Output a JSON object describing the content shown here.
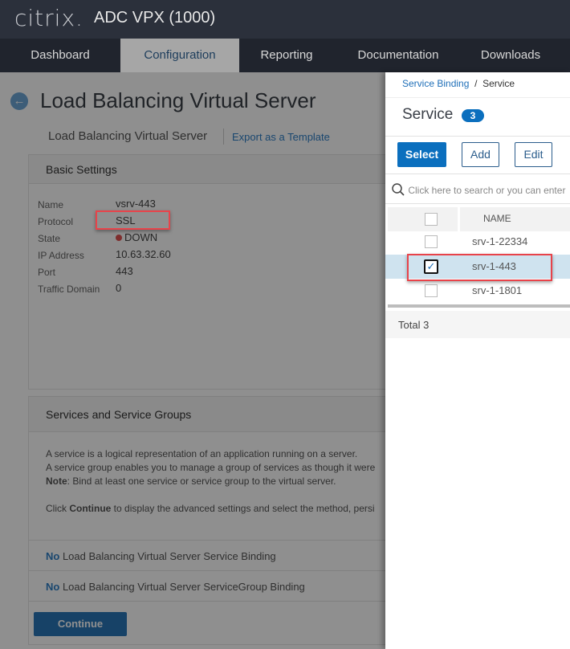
{
  "header": {
    "logo": "citrix.",
    "app_title": "ADC VPX (1000)"
  },
  "nav": {
    "tabs": [
      {
        "label": "Dashboard"
      },
      {
        "label": "Configuration",
        "active": true
      },
      {
        "label": "Reporting"
      },
      {
        "label": "Documentation"
      },
      {
        "label": "Downloads"
      }
    ]
  },
  "page": {
    "title": "Load Balancing Virtual Server",
    "subtitle": "Load Balancing Virtual Server",
    "export_link": "Export as a Template",
    "basic_settings": {
      "heading": "Basic Settings",
      "fields": [
        {
          "label": "Name",
          "value": "vsrv-443"
        },
        {
          "label": "Protocol",
          "value": "SSL"
        },
        {
          "label": "State",
          "value": "DOWN",
          "status_color": "#e05050"
        },
        {
          "label": "IP Address",
          "value": "10.63.32.60"
        },
        {
          "label": "Port",
          "value": "443"
        },
        {
          "label": "Traffic Domain",
          "value": "0"
        }
      ]
    },
    "services": {
      "heading": "Services and Service Groups",
      "line1": "A service is a logical representation of an application running on a server.",
      "line2": "A service group enables you to manage a group of services as though it were",
      "note_label": "Note",
      "note_text": ": Bind at least one service or service group to the virtual server.",
      "click_pre": "Click ",
      "click_bold": "Continue",
      "click_post": " to display the advanced settings and select the method, persi",
      "bindings": [
        {
          "no": "No",
          "text": " Load Balancing Virtual Server Service Binding"
        },
        {
          "no": "No",
          "text": " Load Balancing Virtual Server ServiceGroup Binding"
        }
      ]
    },
    "continue_label": "Continue"
  },
  "panel": {
    "breadcrumb": {
      "parent": "Service Binding",
      "sep": "/",
      "current": "Service"
    },
    "title": "Service",
    "count": "3",
    "buttons": {
      "select": "Select",
      "add": "Add",
      "edit": "Edit"
    },
    "search_placeholder": "Click here to search or you can enter",
    "column": "NAME",
    "rows": [
      {
        "name": "srv-1-22334",
        "checked": false
      },
      {
        "name": "srv-1-443",
        "checked": true
      },
      {
        "name": "srv-1-1801",
        "checked": false
      }
    ],
    "total_label": "Total",
    "total": "3",
    "accent": "#0b6fbe"
  }
}
